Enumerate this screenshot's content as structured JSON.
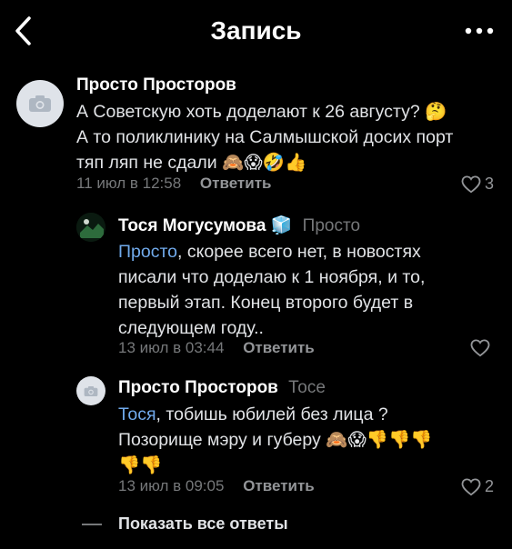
{
  "header": {
    "title": "Запись"
  },
  "comments": [
    {
      "author": "Просто Просторов",
      "reply_to": "",
      "text": "А Советскую хоть доделают к 26 августу? 🤔 А то поликлинику на Салмышской досих порт тяп ляп не сдали 🙈😱🤣👍",
      "lines": [
        "А Советскую хоть доделают к 26 августу? 🤔",
        "А то поликлинику на Салмышской досих порт",
        "тяп ляп не сдали 🙈😱🤣👍"
      ],
      "date": "11 июл в 12:58",
      "reply_label": "Ответить",
      "likes": "3"
    },
    {
      "author": "Тося Могусумова",
      "author_badge": "🧊",
      "reply_to": "Просто",
      "mention": "Просто",
      "lines_rest": [
        ", скорее всего нет, в новостях",
        "писали что доделаю к 1 ноября, и то,",
        "первый этап. Конец второго будет в",
        "следующем году.."
      ],
      "date": "13 июл в 03:44",
      "reply_label": "Ответить",
      "likes": ""
    },
    {
      "author": "Просто Просторов",
      "reply_to": "Тосе",
      "mention": "Тося",
      "lines_rest": [
        ", тобишь юбилей без лица ?",
        "Позорище мэру и губеру 🙈😱👎👎👎",
        "👎👎"
      ],
      "date": "13 июл в 09:05",
      "reply_label": "Ответить",
      "likes": "2"
    }
  ],
  "footer": {
    "show_all_label": "Показать все ответы"
  },
  "icons": {
    "back": "chevron-left-icon",
    "more": "more-horizontal-icon",
    "avatar_placeholder": "camera-icon",
    "like": "heart-outline-icon"
  },
  "colors": {
    "background": "#000000",
    "text": "#e1e3e6",
    "secondary": "#76787a",
    "link": "#71aaeb"
  }
}
